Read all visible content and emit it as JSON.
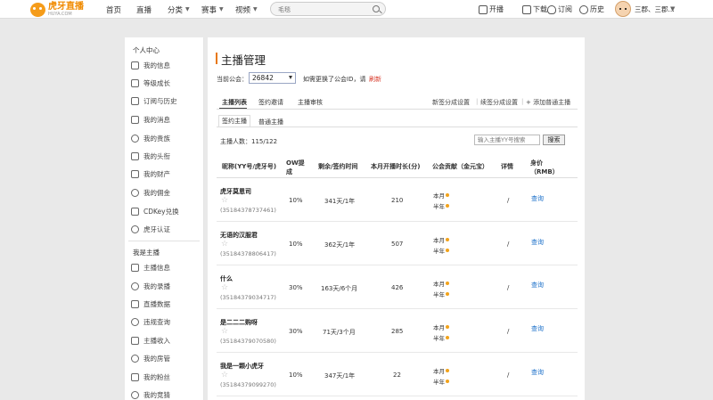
{
  "header": {
    "logo_cn": "虎牙直播",
    "logo_en": "HUYA.COM",
    "nav": [
      "首页",
      "直播",
      "分类",
      "赛事",
      "视频"
    ],
    "search_placeholder": "毛毯",
    "tools": [
      "开播",
      "下载",
      "订阅",
      "历史"
    ],
    "user_name": "三郡、三郡..."
  },
  "sidebar": {
    "section1_title": "个人中心",
    "section1_items": [
      "我的信息",
      "等级成长",
      "订阅与历史",
      "我的消息",
      "我的贵族",
      "我的头衔",
      "我的财产",
      "我的佣金",
      "CDKey兑换",
      "虎牙认证"
    ],
    "section2_title": "我是主播",
    "section2_items": [
      "主播信息",
      "我的录播",
      "直播数据",
      "违规查询",
      "主播收入",
      "我的房管",
      "我的粉丝",
      "我的竞猜"
    ]
  },
  "main": {
    "title": "主播管理",
    "guild_label": "当前公会：",
    "guild_value": "26842",
    "guild_hint": "如需更换了公会ID，请",
    "guild_refresh": "刷新",
    "tabs": [
      "主播列表",
      "签约邀请",
      "主播审核"
    ],
    "actions": [
      "新签分成设置",
      "续签分成设置",
      "+ 添加普通主播"
    ],
    "subtabs": [
      "签约主播",
      "普通主播"
    ],
    "count_label": "主播人数：",
    "count_value": "115/122",
    "search_placeholder": "输入主播YY号搜索",
    "search_button": "搜索",
    "columns": [
      "昵称(YY号/虎牙号)",
      "OW提成",
      "剩余/签约时间",
      "本月开播时长(分)",
      "公会贡献（金元宝）",
      "详情",
      "身价（RMB）"
    ],
    "contrib_labels": [
      "本月",
      "半年"
    ],
    "rows": [
      {
        "name": "虎牙莫恩司",
        "yy": "(35184378737461)",
        "ow": "10%",
        "remain": "341天/1年",
        "minutes": "210",
        "detail": "/",
        "price": "查询"
      },
      {
        "name": "无语的汉服君",
        "yy": "(35184378806417)",
        "ow": "10%",
        "remain": "362天/1年",
        "minutes": "507",
        "detail": "/",
        "price": "查询"
      },
      {
        "name": "什么",
        "yy": "(35184379034717)",
        "ow": "30%",
        "remain": "163天/6个月",
        "minutes": "426",
        "detail": "/",
        "price": "查询"
      },
      {
        "name": "是二二二购呀",
        "yy": "(35184379070580)",
        "ow": "30%",
        "remain": "71天/3个月",
        "minutes": "285",
        "detail": "/",
        "price": "查询"
      },
      {
        "name": "我是一颗小虎牙",
        "yy": "(35184379099270)",
        "ow": "10%",
        "remain": "347天/1年",
        "minutes": "22",
        "detail": "/",
        "price": "查询"
      }
    ]
  },
  "colors": {
    "accent": "#e8770f",
    "link": "#1a6fc9",
    "refresh": "#d83a2a"
  }
}
